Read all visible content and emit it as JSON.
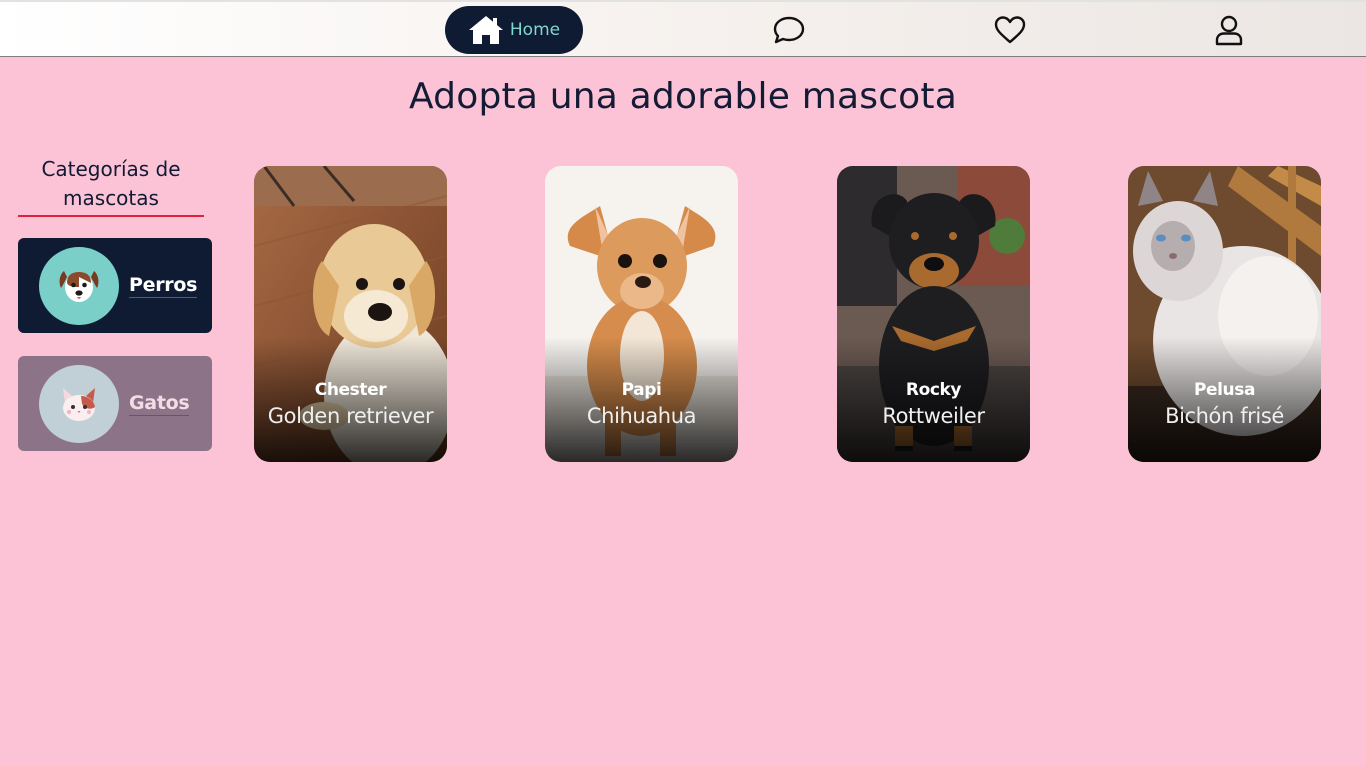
{
  "nav": {
    "home_label": "Home",
    "accent_color": "#7fd8cf",
    "pill_color": "#0f1a33",
    "icons": [
      "home-icon",
      "chat-icon",
      "heart-icon",
      "user-icon"
    ]
  },
  "page_title": "Adopta una adorable mascota",
  "sidebar": {
    "heading": "Categorías de mascotas",
    "categories": [
      {
        "label": "Perros",
        "icon": "dog-face-icon",
        "selected": true,
        "color": "#0f1a33"
      },
      {
        "label": "Gatos",
        "icon": "cat-face-icon",
        "selected": false,
        "color": "#8c7387"
      }
    ]
  },
  "pets": [
    {
      "name": "Chester",
      "breed": "Golden retriever",
      "image": "golden-retriever-puppy-photo"
    },
    {
      "name": "Papi",
      "breed": "Chihuahua",
      "image": "chihuahua-puppy-photo"
    },
    {
      "name": "Rocky",
      "breed": "Rottweiler",
      "image": "rottweiler-puppy-photo"
    },
    {
      "name": "Pelusa",
      "breed": "Bichón frisé",
      "image": "white-fluffy-cat-photo"
    }
  ],
  "colors": {
    "background": "#fcc3d6",
    "underline": "#e0213d",
    "text": "#131b35"
  }
}
